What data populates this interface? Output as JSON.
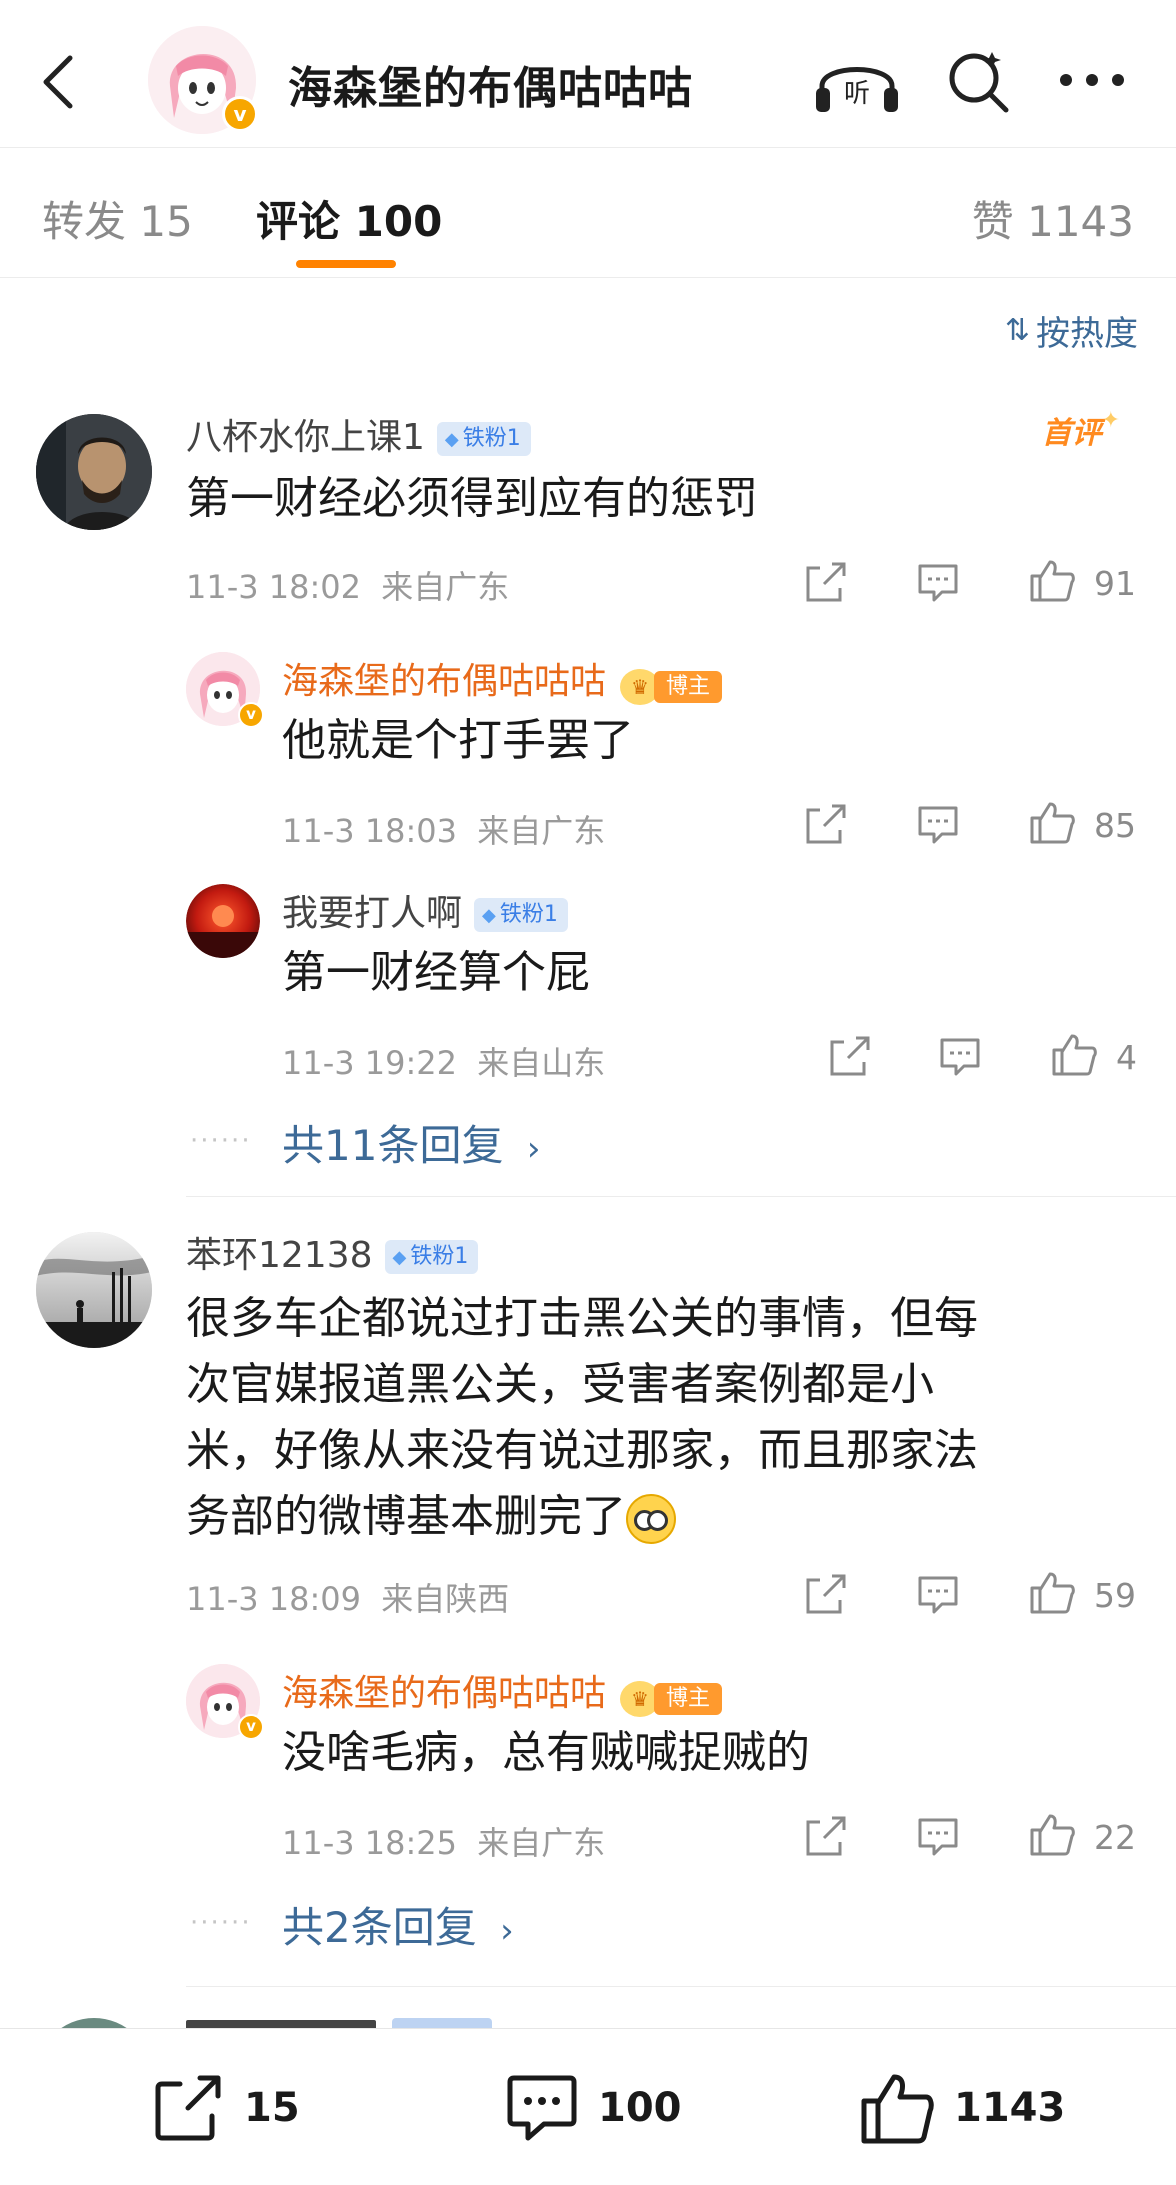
{
  "header": {
    "title": "海森堡的布偶咕咕咕",
    "listen_label": "听",
    "verified_mark": "v"
  },
  "tabs": {
    "repost_label": "转发 15",
    "comment_label": "评论 100",
    "like_label": "赞 1143",
    "active": "comment"
  },
  "sort": {
    "label": "按热度",
    "icon": "sort-icon"
  },
  "comments": [
    {
      "username": "八杯水你上课1",
      "badge": "铁粉1",
      "first_label": "首评",
      "text": "第一财经必须得到应有的惩罚",
      "time": "11-3 18:02",
      "location": "来自广东",
      "likes": "91",
      "replies": [
        {
          "username": "海森堡的布偶咕咕咕",
          "badge": "博主",
          "text": "他就是个打手罢了",
          "time": "11-3 18:03",
          "location": "来自广东",
          "likes": "85"
        },
        {
          "username": "我要打人啊",
          "badge": "铁粉1",
          "text": "第一财经算个屁",
          "time": "11-3 19:22",
          "location": "来自山东",
          "likes": "4"
        }
      ],
      "more_replies": "共11条回复"
    },
    {
      "username": "苯环12138",
      "badge": "铁粉1",
      "text_lines": [
        "很多车企都说过打击黑公关的事情，但每",
        "次官媒报道黑公关，受害者案例都是小",
        "米，好像从来没有说过那家，而且那家法",
        "务部的微博基本删完了"
      ],
      "time": "11-3 18:09",
      "location": "来自陕西",
      "likes": "59",
      "replies": [
        {
          "username": "海森堡的布偶咕咕咕",
          "badge": "博主",
          "text": "没啥毛病，总有贼喊捉贼的",
          "time": "11-3 18:25",
          "location": "来自广东",
          "likes": "22"
        }
      ],
      "more_replies": "共2条回复"
    }
  ],
  "bottom_bar": {
    "repost_count": "15",
    "comment_count": "100",
    "like_count": "1143"
  },
  "colors": {
    "accent_orange": "#ff8200",
    "link_blue": "#3d6a97",
    "author_orange": "#e86a1a",
    "fan_badge_bg": "#dde9f8"
  }
}
